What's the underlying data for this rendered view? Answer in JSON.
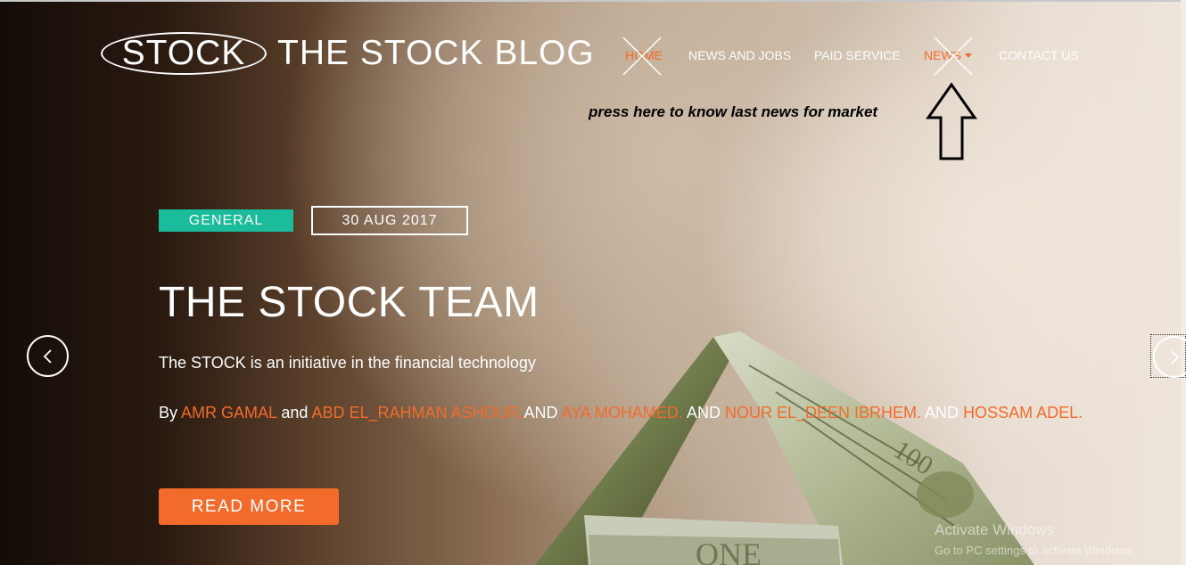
{
  "header": {
    "logo_text": "STOCK",
    "brand_title": "THE STOCK BLOG"
  },
  "nav": {
    "items": [
      {
        "label": "HOME",
        "active": true,
        "crossed_out": true
      },
      {
        "label": "NEWS AND JOBS"
      },
      {
        "label": "PAID SERVICE"
      },
      {
        "label": "NEWS",
        "dropdown": true,
        "crossed_out": true
      },
      {
        "label": "CONTACT US"
      }
    ]
  },
  "annotation": {
    "text": "press here to know last news for market",
    "arrow_icon": "up-arrow-outline-icon"
  },
  "slide": {
    "category": "GENERAL",
    "date": "30 AUG 2017",
    "title": "THE STOCK TEAM",
    "subtitle": "The STOCK is an initiative in the financial technology",
    "credits": {
      "by": "By",
      "name1": "AMR GAMAL",
      "and1": "and",
      "name2": "ABD EL_RAHMAN ASHOUR.",
      "and2": "AND",
      "name3": "AYA MOHAMED.",
      "and3": "AND",
      "name4": "NOUR EL_DEEN IBRHEM.",
      "and4": "AND",
      "name5": "HOSSAM ADEL."
    },
    "read_more_label": "READ MORE"
  },
  "carousel": {
    "prev_icon": "chevron-left-icon",
    "next_icon": "chevron-right-icon"
  },
  "watermark": {
    "line1": "Activate Windows",
    "line2": "Go to PC settings to activate Windows."
  },
  "colors": {
    "accent": "#f26b2a",
    "tag_green": "#1bbc9b"
  }
}
